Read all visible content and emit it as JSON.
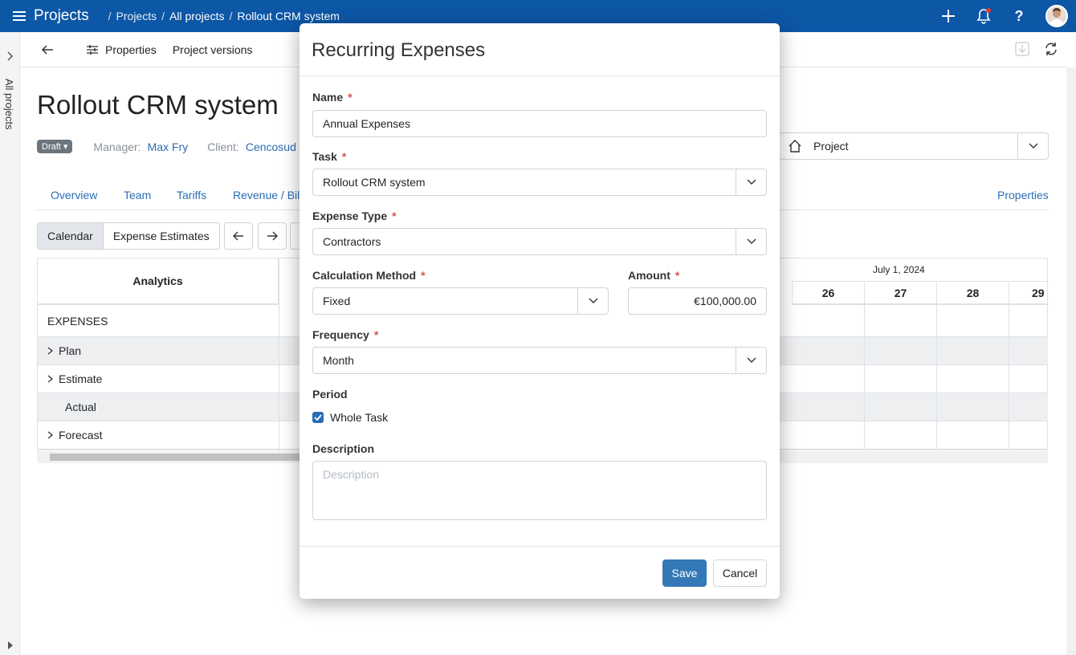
{
  "topbar": {
    "app_title": "Projects",
    "breadcrumbs": [
      "Projects",
      "All projects",
      "Rollout CRM system"
    ]
  },
  "leftrail": {
    "label": "All projects"
  },
  "toolbar": {
    "properties": "Properties",
    "versions": "Project versions"
  },
  "project": {
    "title": "Rollout CRM system",
    "status": "Draft",
    "manager_label": "Manager:",
    "manager": "Max Fry",
    "client_label": "Client:",
    "client": "Cencosud S",
    "selector": "Project"
  },
  "tabs": [
    "Overview",
    "Team",
    "Tariffs",
    "Revenue / Bill",
    "Properties"
  ],
  "view_toggle": {
    "calendar": "Calendar",
    "estimates": "Expense Estimates"
  },
  "grid": {
    "analytics": "Analytics",
    "section": "EXPENSES",
    "rows": [
      "Plan",
      "Estimate",
      "Actual",
      "Forecast"
    ],
    "month": "July 1, 2024",
    "days": [
      "26",
      "27",
      "28",
      "29"
    ]
  },
  "modal": {
    "title": "Recurring Expenses",
    "name_label": "Name",
    "name_value": "Annual Expenses",
    "task_label": "Task",
    "task_value": "Rollout CRM system",
    "type_label": "Expense Type",
    "type_value": "Contractors",
    "method_label": "Calculation Method",
    "method_value": "Fixed",
    "amount_label": "Amount",
    "amount_value": "€100,000.00",
    "freq_label": "Frequency",
    "freq_value": "Month",
    "period_label": "Period",
    "whole_task": "Whole Task",
    "desc_label": "Description",
    "desc_placeholder": "Description",
    "save": "Save",
    "cancel": "Cancel",
    "required_mark": "*"
  },
  "colors": {
    "brand": "#0d57a7",
    "accent": "#3478b8",
    "required": "#d9534f"
  }
}
